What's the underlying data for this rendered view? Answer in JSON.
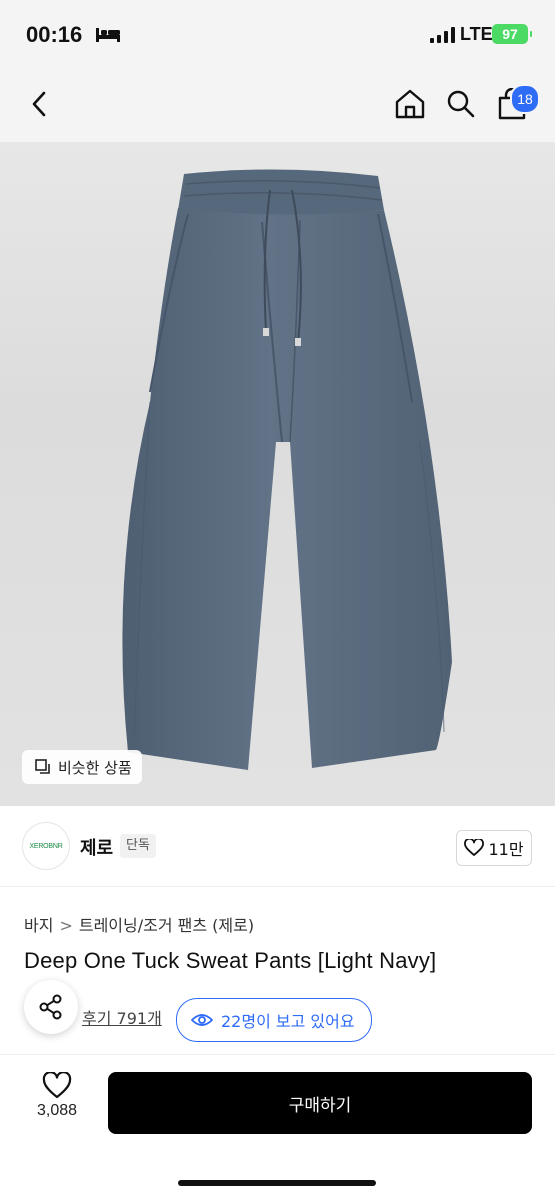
{
  "status_bar": {
    "time": "00:16",
    "network": "LTE",
    "battery": "97"
  },
  "nav": {
    "cart_count": "18"
  },
  "image": {
    "similar_label": "비슷한 상품"
  },
  "seller": {
    "logo_text": "XEROBNR",
    "name": "제로",
    "badge": "단독",
    "like_count": "11만"
  },
  "product": {
    "breadcrumb": [
      "바지",
      "트레이닝/조거 팬츠 (제로)"
    ],
    "title": "Deep One Tuck Sweat Pants [Light Navy]",
    "reviews": "후기 791개",
    "viewers": "22명이 보고 있어요"
  },
  "bottom": {
    "favorite_count": "3,088",
    "buy_label": "구매하기"
  },
  "colors": {
    "accent": "#2f6cf6",
    "buy_button": "#000000",
    "pants": "#5b6b7e",
    "battery": "#4cd964"
  }
}
